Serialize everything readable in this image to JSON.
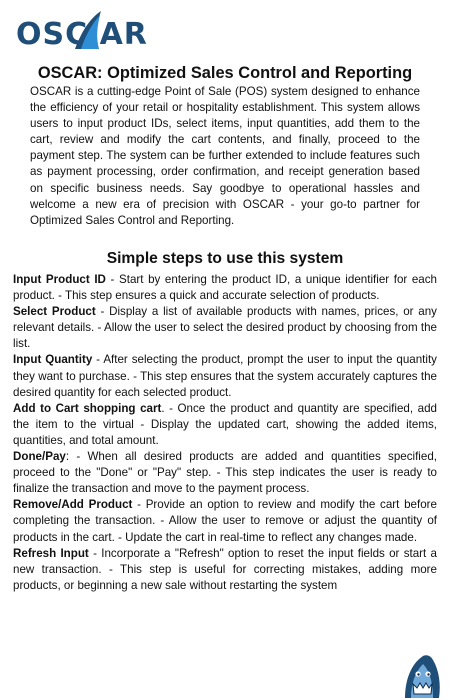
{
  "logo": {
    "text": "OSC AR"
  },
  "title": "OSCAR: Optimized Sales Control and Reporting",
  "intro": "OSCAR is a cutting-edge Point of Sale (POS) system designed to enhance the efficiency of your retail or hospitality establishment. This system allows users to input product IDs, select items, input quantities, add them to the cart, review and modify the cart contents, and finally, proceed to the payment step. The system can be further extended to include features such as payment processing, order confirmation, and receipt generation based on specific business needs. Say goodbye to operational hassles and welcome a new era of precision with OSCAR - your go-to partner for Optimized Sales Control and Reporting.",
  "subtitle": "Simple steps to use this system",
  "steps": [
    {
      "name": "Input Product ID",
      "text": " - Start by entering the product ID, a unique identifier for each product. - This step ensures a quick and accurate selection of products."
    },
    {
      "name": "Select Product",
      "text": " - Display a list of available products with names, prices, or any relevant details. - Allow the user to select the desired product by choosing from the list."
    },
    {
      "name": "Input Quantity",
      "text": " - After selecting the product, prompt the user to input the quantity they want to purchase. - This step ensures that the system accurately captures the desired quantity for each selected product."
    },
    {
      "name": "Add to Cart shopping cart",
      "text": ". - Once the product and quantity are specified, add the item to the virtual - Display the updated cart, showing the added items, quantities, and total amount."
    },
    {
      "name": "Done/Pay",
      "text": ": - When all desired products are added and quantities specified, proceed to the \"Done\" or \"Pay\" step. - This step indicates the user is ready to finalize the transaction and move to the payment process."
    },
    {
      "name": "Remove/Add Product",
      "text": " - Provide an option to review and modify the cart before completing the transaction. - Allow the user to remove or adjust the quantity of products in the cart. - Update the cart in real-time to reflect any changes made."
    },
    {
      "name": "Refresh Input",
      "text": " - Incorporate a \"Refresh\" option to reset the input fields or start a new transaction. - This step is useful for correcting mistakes, adding more products, or beginning a new sale without restarting the system"
    }
  ],
  "colors": {
    "logo_blue": "#1f4e79",
    "accent_blue": "#2f8fd6"
  },
  "icons": {
    "logo_fin": "shark-fin-icon",
    "mascot": "shark-mascot-icon"
  }
}
